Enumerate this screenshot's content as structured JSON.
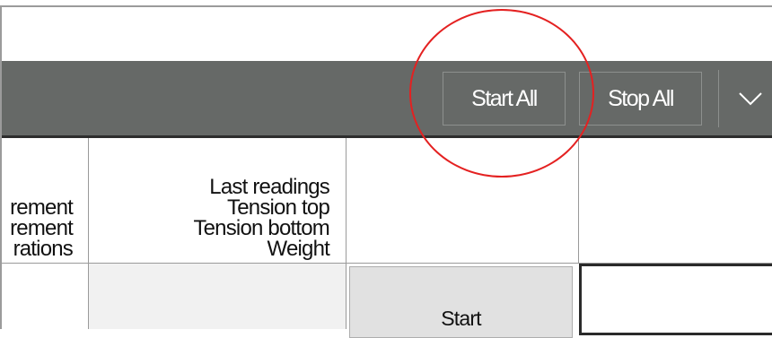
{
  "toolbar": {
    "start_all_label": "Start All",
    "stop_all_label": "Stop All",
    "overflow_icon": "chevron-down-icon",
    "background_color": "#666967"
  },
  "table": {
    "header_partial_lines": [
      "rement",
      "rement",
      "rations"
    ],
    "header_last_readings_lines": [
      "Last readings",
      "Tension top",
      "Tension bottom",
      "Weight"
    ],
    "row_start_label": "Start"
  },
  "annotation": {
    "highlight_color": "#e42121"
  }
}
